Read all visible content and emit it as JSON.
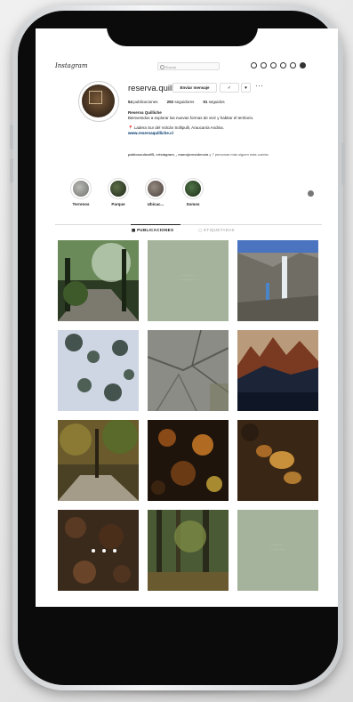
{
  "app": {
    "logo": "Instagram"
  },
  "search": {
    "placeholder": "Buscar"
  },
  "nav_icons": [
    "home-icon",
    "messenger-icon",
    "new-post-icon",
    "explore-icon",
    "heart-icon",
    "profile-icon"
  ],
  "profile": {
    "username": "reserva.quilliche",
    "message_button": "Enviar mensaje",
    "follow_icon": "person-check-icon",
    "dropdown_icon": "chevron-down-icon",
    "more": "···",
    "stats": {
      "posts_count": "54",
      "posts_label": "publicaciones",
      "followers_count": "292",
      "followers_label": "seguidores",
      "following_count": "91",
      "following_label": "seguidos"
    },
    "bio": {
      "name": "Reserva Quilliche",
      "line1": "Bienvenidos a explorar las nuevas formas de vivir y habitar el territorio.",
      "location": "📍 Ladera Sur del Volcán Sollipulli, Araucanía Andina.",
      "link": "www.reservaquilliche.cl"
    },
    "followed_by": {
      "names": "pablosoulma95, cristagram_, manojoresidencia",
      "rest": "y 7 personas más siguen esta cuenta"
    }
  },
  "highlights": [
    {
      "label": "Terrenos",
      "color": "#8e8f8a"
    },
    {
      "label": "Parque",
      "color": "#3a4a2c"
    },
    {
      "label": "Ubicac...",
      "color": "#6a5f58"
    },
    {
      "label": "Somos",
      "color": "#2f4a2a"
    }
  ],
  "tabs": {
    "posts": "PUBLICACIONES",
    "tagged": "ETIQUETADAS"
  },
  "colors": {
    "accent_green": "#a6b39c",
    "link_blue": "#00376b"
  }
}
